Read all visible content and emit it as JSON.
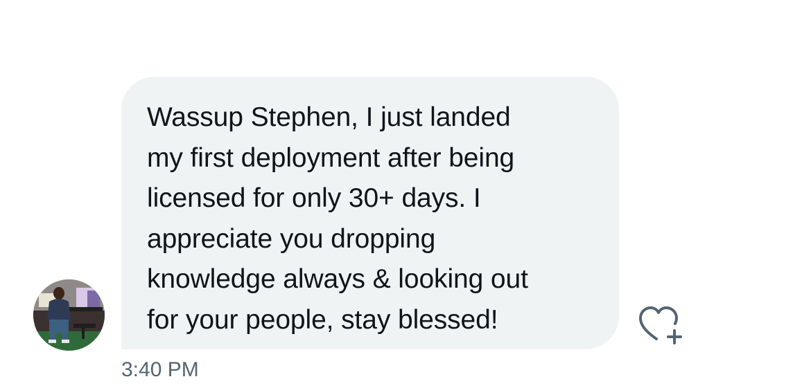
{
  "message": {
    "text": "Wassup Stephen, I just landed\nmy first deployment after being\nlicensed for only 30+ days. I\nappreciate you dropping\nknowledge always & looking out\nfor your people, stay blessed!",
    "timestamp": "3:40 PM"
  },
  "icons": {
    "avatar": "user-avatar-photo",
    "react": "heart-plus-icon"
  },
  "colors": {
    "bubble": "#eff3f4",
    "text": "#0f1419",
    "timestamp": "#536471",
    "icon": "#536471"
  }
}
